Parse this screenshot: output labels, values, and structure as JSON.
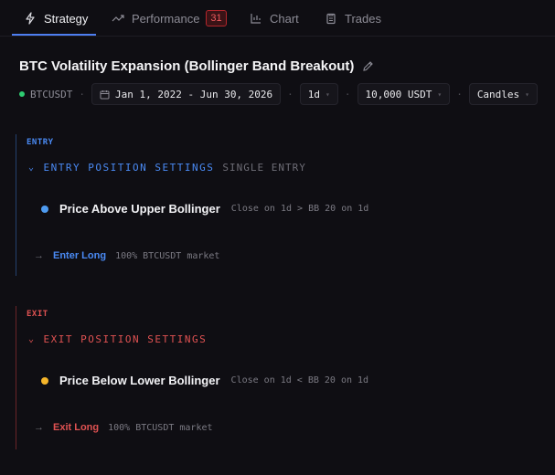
{
  "tabs": [
    {
      "label": "Strategy",
      "icon": "bolt-icon"
    },
    {
      "label": "Performance",
      "icon": "trending-icon",
      "badge": "31"
    },
    {
      "label": "Chart",
      "icon": "chart-icon"
    },
    {
      "label": "Trades",
      "icon": "clipboard-icon"
    }
  ],
  "title": "BTC Volatility Expansion (Bollinger Band Breakout)",
  "meta": {
    "symbol": "BTCUSDT",
    "date_range": "Jan 1, 2022 - Jun 30, 2026",
    "interval": "1d",
    "capital": "10,000 USDT",
    "chart_type": "Candles"
  },
  "entry": {
    "label": "ENTRY",
    "heading": "ENTRY POSITION SETTINGS",
    "subheading": "SINGLE ENTRY",
    "condition_name": "Price Above Upper Bollinger",
    "condition_desc": "Close on 1d > BB 20 on 1d",
    "action_label": "Enter Long",
    "action_detail": "100% BTCUSDT market"
  },
  "exit": {
    "label": "EXIT",
    "heading": "EXIT POSITION SETTINGS",
    "condition_name": "Price Below Lower Bollinger",
    "condition_desc": "Close on 1d < BB 20 on 1d",
    "action_label": "Exit Long",
    "action_detail": "100% BTCUSDT market"
  },
  "colors": {
    "accent_blue": "#4d7ef0",
    "entry_blue": "#4a8af4",
    "exit_red": "#e05252",
    "status_green": "#2ecc71",
    "badge_red": "#f05a5f",
    "cond_blue": "#4e9bf0",
    "cond_yellow": "#f5b52a"
  }
}
